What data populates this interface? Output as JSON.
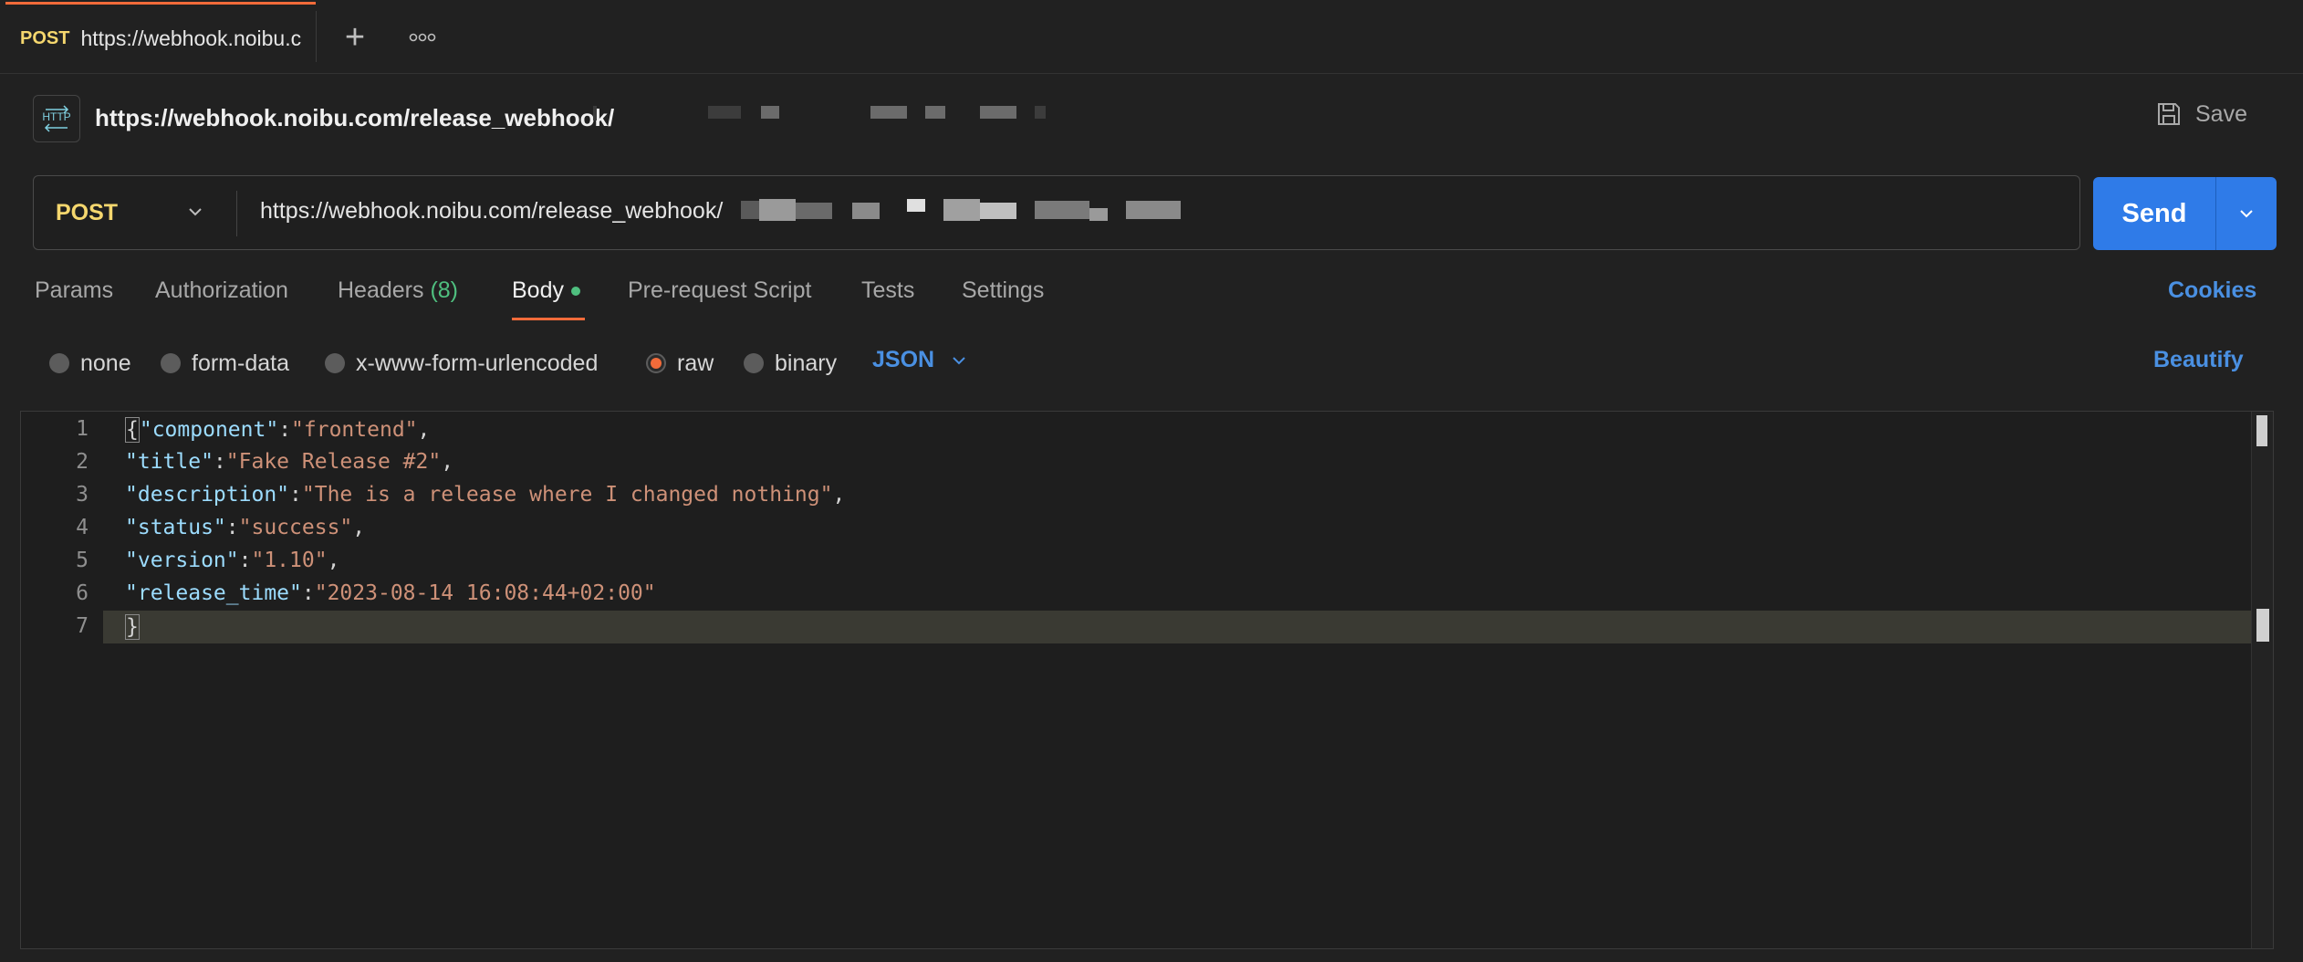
{
  "tab": {
    "method": "POST",
    "title": "https://webhook.noibu.c"
  },
  "header": {
    "title": "https://webhook.noibu.com/release_webhook/",
    "save_label": "Save",
    "http_icon_label": "HTTP"
  },
  "request": {
    "method": "POST",
    "url": "https://webhook.noibu.com/release_webhook/",
    "send_label": "Send"
  },
  "tabs": {
    "params": "Params",
    "authorization": "Authorization",
    "headers": "Headers",
    "headers_count": "(8)",
    "body": "Body",
    "pre_request": "Pre-request Script",
    "tests": "Tests",
    "settings": "Settings",
    "cookies": "Cookies"
  },
  "body_types": {
    "none": "none",
    "form_data": "form-data",
    "urlencoded": "x-www-form-urlencoded",
    "raw": "raw",
    "binary": "binary",
    "format": "JSON",
    "beautify": "Beautify"
  },
  "editor": {
    "line_numbers": [
      "1",
      "2",
      "3",
      "4",
      "5",
      "6",
      "7"
    ],
    "lines": [
      {
        "open": "{",
        "key": "\"component\"",
        "colon": ":",
        "value": "\"frontend\"",
        "comma": ","
      },
      {
        "key": "\"title\"",
        "colon": ":",
        "value": "\"Fake Release #2\"",
        "comma": ","
      },
      {
        "key": "\"description\"",
        "colon": ":",
        "value": "\"The is a release where I changed nothing\"",
        "comma": ","
      },
      {
        "key": "\"status\"",
        "colon": ":",
        "value": "\"success\"",
        "comma": ","
      },
      {
        "key": "\"version\"",
        "colon": ":",
        "value": "\"1.10\"",
        "comma": ","
      },
      {
        "key": "\"release_time\"",
        "colon": ":",
        "value": "\"2023-08-14 16:08:44+02:00\""
      },
      {
        "close": "}"
      }
    ]
  },
  "colors": {
    "accent": "#f26b3a",
    "primary": "#2f7be8",
    "method": "#f5d76e",
    "link": "#4a90e2",
    "success": "#4fbf7f"
  }
}
